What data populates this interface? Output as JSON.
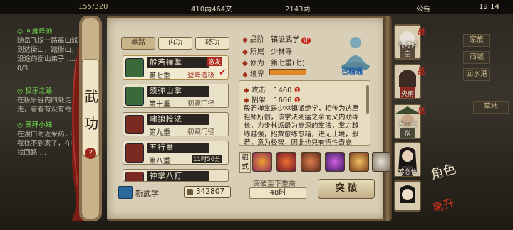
{
  "topbar": {
    "stamina": "155/320",
    "coins": "410两464文",
    "gold": "2143两",
    "notice": "公告",
    "time": "19:14"
  },
  "quests": [
    {
      "title": "◎ 回雁峰顶",
      "body": "随岳飞探一路离山派到达衡山，踏衡山，沿途的衡山弟子 …… 0/3"
    },
    {
      "title": "◎ 极乐之路",
      "body": "在极乐谷内四处走走，看看有没有奇遇"
    },
    {
      "title": "◎ 葵拜小妹",
      "body": "在渡口附近采药，在我找不到家了，在我找回路 …"
    }
  ],
  "right_tabs": [
    "家族",
    "商城",
    "回水港",
    "草地"
  ],
  "scroll_title": [
    "武",
    "功"
  ],
  "tabs": [
    "拳路",
    "内功",
    "轻功"
  ],
  "skills": [
    {
      "name": "般若禅掌",
      "level": "第七重",
      "rank": "登峰造极",
      "badge": "激发",
      "color": "#3a6a3a"
    },
    {
      "name": "须弥山掌",
      "level": "第十重",
      "rank": "初窥门径",
      "color": "#3a6a3a"
    },
    {
      "name": "啸狼枪法",
      "level": "第九重",
      "rank": "初窥门径",
      "color": "#7a2a20"
    },
    {
      "name": "五行拳",
      "level": "第八重",
      "rank": "11时56分",
      "color": "#7a2a20"
    },
    {
      "name": "神掌八打",
      "level": "",
      "rank": "",
      "color": "#7a2a20"
    }
  ],
  "new_skill": {
    "label": "新武学",
    "count": "342807"
  },
  "detail": {
    "grade_label": "品阶",
    "grade": "镇派武学",
    "grade_badge": "评",
    "school_label": "所属",
    "school": "少林寺",
    "cult_label": "修为",
    "cult": "第七重(七)",
    "realm_label": "境界",
    "mastered": "已精通",
    "stats": [
      {
        "label": "攻击",
        "value": "1460"
      },
      {
        "label": "招架",
        "value": "1606"
      }
    ],
    "description": "般若禅掌是少林镇派绝学，相传为达摩祖师所创，该掌法刚猛之余而又内劲绵长，力步林派最为高深的掌法，掌力越练越强，招数愈练愈精，进无止境，般若，意为极智，因此也只有悟性奇高者，才能完全发挥出这",
    "moves_label": [
      "招",
      "式"
    ],
    "break_hint": "突破至下重需",
    "break_time": "48时",
    "break_button": "突 破"
  },
  "party": [
    {
      "name": "九灯禅空",
      "tag": "战"
    },
    {
      "name": "央雨",
      "tag": "战"
    },
    {
      "name": "大王老僧",
      "tag": "战"
    },
    {
      "name": "苏念信",
      "tag": ""
    },
    {
      "name": "",
      "tag": ""
    }
  ],
  "corner": [
    "角色",
    "离开"
  ]
}
